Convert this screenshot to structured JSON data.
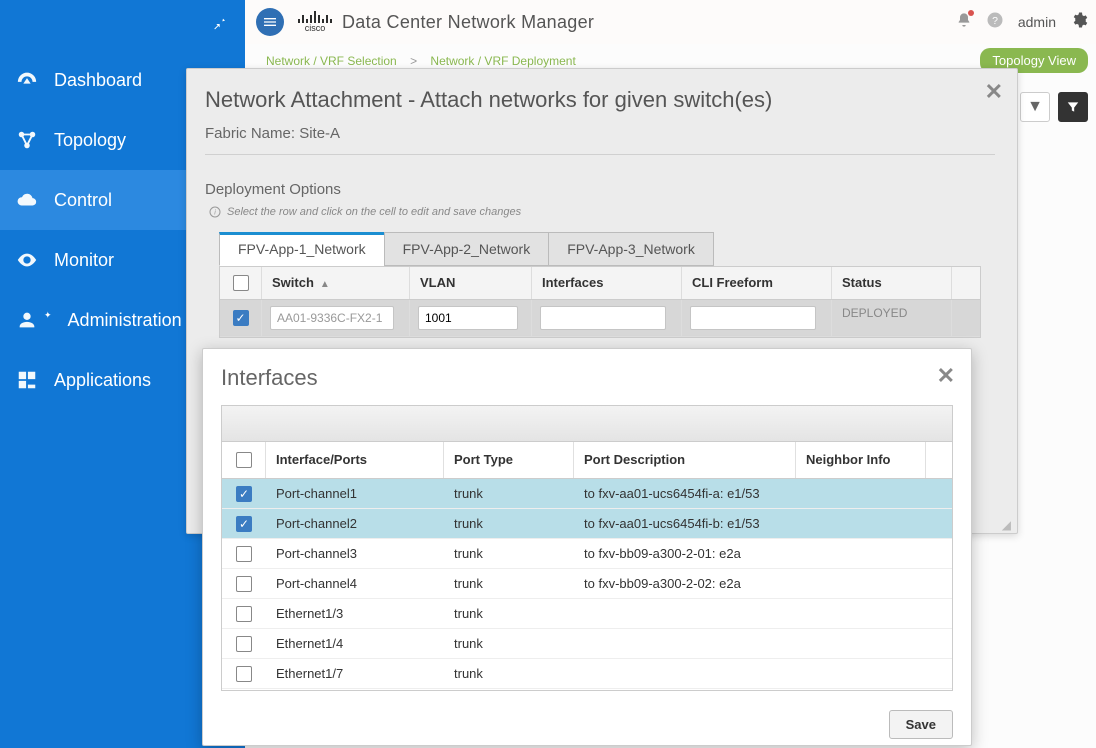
{
  "header": {
    "title": "Data Center Network Manager",
    "brand_text": "cisco",
    "user_label": "admin"
  },
  "sidebar": {
    "items": [
      {
        "label": "Dashboard"
      },
      {
        "label": "Topology"
      },
      {
        "label": "Control"
      },
      {
        "label": "Monitor"
      },
      {
        "label": "Administration"
      },
      {
        "label": "Applications"
      }
    ]
  },
  "breadcrumb": {
    "step1": "Network / VRF Selection",
    "sep": ">",
    "step2": "Network / VRF Deployment"
  },
  "topology_button": "Topology View",
  "modal1": {
    "title": "Network Attachment - Attach networks for given switch(es)",
    "fabric_label": "Fabric Name:",
    "fabric_value": "Site-A",
    "deploy_label": "Deployment Options",
    "hint": "Select the row and click on the cell to edit and save changes",
    "tabs": [
      "FPV-App-1_Network",
      "FPV-App-2_Network",
      "FPV-App-3_Network"
    ],
    "columns": {
      "switch": "Switch",
      "vlan": "VLAN",
      "interfaces": "Interfaces",
      "cli": "CLI Freeform",
      "status": "Status"
    },
    "row": {
      "checked": true,
      "switch": "AA01-9336C-FX2-1",
      "vlan": "1001",
      "interfaces": "",
      "cli": "",
      "status": "DEPLOYED"
    }
  },
  "modal2": {
    "title": "Interfaces",
    "columns": {
      "ip": "Interface/Ports",
      "pt": "Port Type",
      "pd": "Port Description",
      "ni": "Neighbor Info"
    },
    "rows": [
      {
        "checked": true,
        "ip": "Port-channel1",
        "pt": "trunk",
        "pd": "to fxv-aa01-ucs6454fi-a: e1/53",
        "ni": ""
      },
      {
        "checked": true,
        "ip": "Port-channel2",
        "pt": "trunk",
        "pd": "to fxv-aa01-ucs6454fi-b: e1/53",
        "ni": ""
      },
      {
        "checked": false,
        "ip": "Port-channel3",
        "pt": "trunk",
        "pd": "to fxv-bb09-a300-2-01: e2a",
        "ni": ""
      },
      {
        "checked": false,
        "ip": "Port-channel4",
        "pt": "trunk",
        "pd": "to fxv-bb09-a300-2-02: e2a",
        "ni": ""
      },
      {
        "checked": false,
        "ip": "Ethernet1/3",
        "pt": "trunk",
        "pd": "",
        "ni": ""
      },
      {
        "checked": false,
        "ip": "Ethernet1/4",
        "pt": "trunk",
        "pd": "",
        "ni": ""
      },
      {
        "checked": false,
        "ip": "Ethernet1/7",
        "pt": "trunk",
        "pd": "",
        "ni": ""
      }
    ],
    "save_label": "Save"
  }
}
